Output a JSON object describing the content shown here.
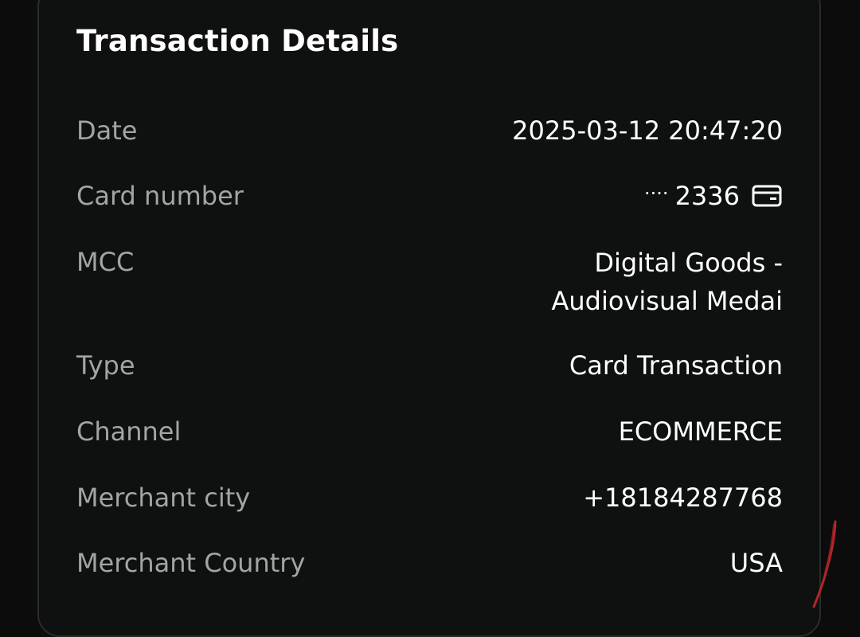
{
  "header": {
    "title": "Transaction Details"
  },
  "details": {
    "date": {
      "label": "Date",
      "value": "2025-03-12 20:47:20"
    },
    "card_number": {
      "label": "Card number",
      "mask": "····",
      "last4": "2336",
      "icon": "card-icon"
    },
    "mcc": {
      "label": "MCC",
      "value_line1": "Digital Goods -",
      "value_line2": "Audiovisual Medai"
    },
    "type": {
      "label": "Type",
      "value": "Card Transaction"
    },
    "channel": {
      "label": "Channel",
      "value": "ECOMMERCE"
    },
    "merchant_city": {
      "label": "Merchant city",
      "value": "+18184287768"
    },
    "merchant_country": {
      "label": "Merchant Country",
      "value": "USA"
    }
  },
  "colors": {
    "background": "#0c0c0c",
    "card": "#0f1010",
    "label": "#a3a4a4",
    "value": "#ffffff",
    "annotation": "#b3262a"
  }
}
